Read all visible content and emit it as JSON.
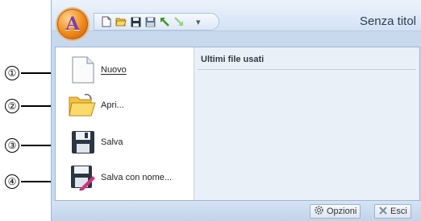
{
  "window": {
    "title": "Senza titol"
  },
  "app_button": {
    "letter": "A",
    "icon": "application-orb-icon"
  },
  "quick_access": {
    "buttons": [
      {
        "name": "new-doc-icon"
      },
      {
        "name": "open-folder-icon"
      },
      {
        "name": "save-icon"
      },
      {
        "name": "save-as-icon"
      },
      {
        "name": "undo-icon"
      },
      {
        "name": "redo-icon"
      }
    ],
    "customize_glyph": "▾"
  },
  "callouts": [
    "①",
    "②",
    "③",
    "④"
  ],
  "menu": {
    "items": [
      {
        "label": "Nuovo",
        "icon": "new-document-icon"
      },
      {
        "label": "Apri...",
        "icon": "open-folder-icon"
      },
      {
        "label": "Salva",
        "icon": "floppy-disk-icon"
      },
      {
        "label": "Salva con nome...",
        "icon": "save-as-pen-icon"
      }
    ],
    "recent_title": "Ultimi file usati"
  },
  "bottom": {
    "options_label": "Opzioni",
    "exit_label": "Esci"
  }
}
